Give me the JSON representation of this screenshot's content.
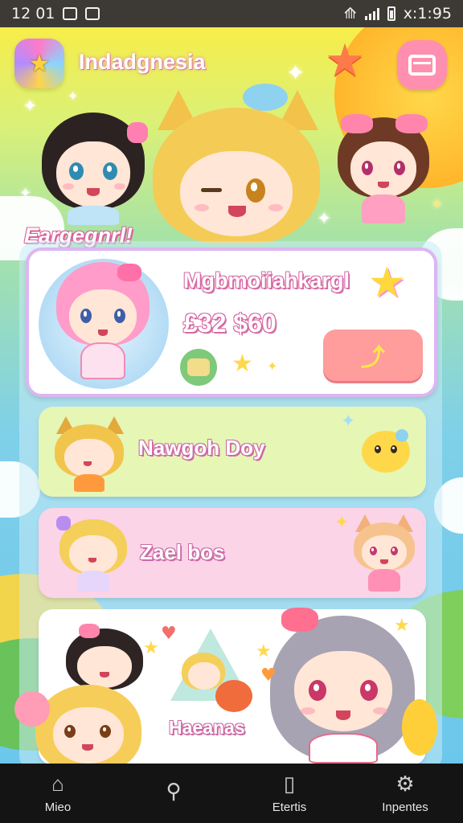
{
  "status_bar": {
    "time": "12 01",
    "right_text": "x:1:95"
  },
  "header": {
    "app_title": "Indadgnesia",
    "logo_icon": "app-logo-icon",
    "menu_icon": "wallet-card-icon"
  },
  "banner": {
    "label": "Eargegnrl!"
  },
  "featured": {
    "name": "Mgbmoiiahkargl",
    "price": "£32 $60",
    "button_icon": "play-arrow-icon",
    "button_glyph": "⤴"
  },
  "list": [
    {
      "label": "Nawgoh Doy",
      "color": "#e6f6b5"
    },
    {
      "label": "Zael bos",
      "color": "#fbd4e8"
    },
    {
      "label": "Haeanas",
      "color": "#ffffff"
    }
  ],
  "bottom_nav": {
    "items": [
      {
        "label": "Mieo",
        "icon": "home-icon"
      },
      {
        "label": "",
        "icon": "pin-icon"
      },
      {
        "label": "Etertis",
        "icon": "document-icon"
      },
      {
        "label": "Inpentes",
        "icon": "gear-icon"
      }
    ]
  },
  "colors": {
    "accent_pink": "#ff8fb0",
    "status_bar": "#3d3a36",
    "nav_bar": "#141414",
    "outline_pink": "#d66aa4"
  }
}
